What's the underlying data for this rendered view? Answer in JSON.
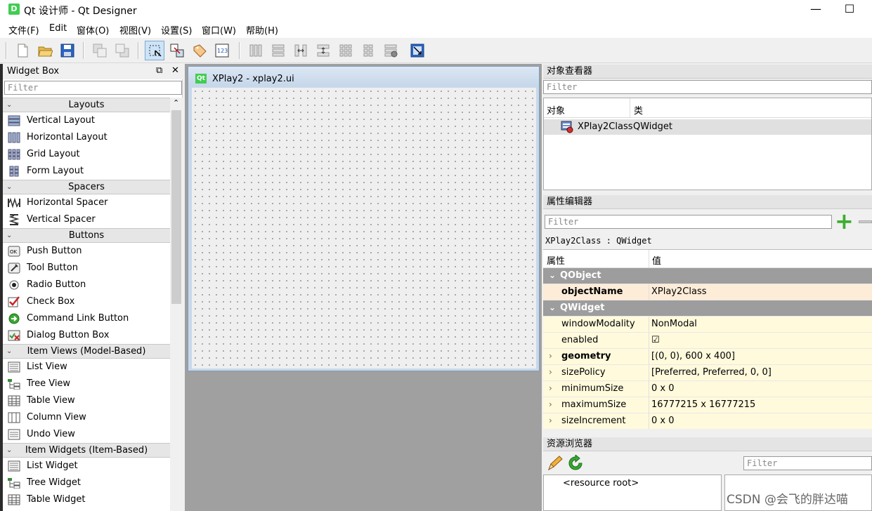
{
  "window": {
    "app_icon_letter": "D",
    "title": "Qt 设计师 - Qt Designer",
    "minimize": "—",
    "maximize": "☐"
  },
  "menu": [
    "文件(F)",
    "Edit",
    "窗体(O)",
    "视图(V)",
    "设置(S)",
    "窗口(W)",
    "帮助(H)"
  ],
  "toolbar": {
    "groups": [
      [
        "new-file-icon",
        "open-folder-icon",
        "save-icon"
      ],
      [
        "send-to-back-icon",
        "bring-to-front-icon"
      ],
      [
        "edit-widgets-icon",
        "edit-signals-slots-icon",
        "edit-buddies-icon",
        "edit-tab-order-icon"
      ],
      [
        "layout-horizontal-icon",
        "layout-vertical-icon",
        "layout-h-splitter-icon",
        "layout-v-splitter-icon",
        "layout-grid-icon",
        "layout-form-icon",
        "break-layout-icon",
        "adjust-size-icon"
      ]
    ],
    "active": "edit-widgets-icon"
  },
  "widget_box": {
    "title": "Widget Box",
    "float_icon": "⧉",
    "close_icon": "✕",
    "filter_placeholder": "Filter",
    "collapse_icon": "⌃",
    "sections": [
      {
        "name": "Layouts",
        "items": [
          {
            "label": "Vertical Layout",
            "icon": "vertical-layout-icon"
          },
          {
            "label": "Horizontal Layout",
            "icon": "horizontal-layout-icon"
          },
          {
            "label": "Grid Layout",
            "icon": "grid-layout-icon"
          },
          {
            "label": "Form Layout",
            "icon": "form-layout-icon"
          }
        ]
      },
      {
        "name": "Spacers",
        "items": [
          {
            "label": "Horizontal Spacer",
            "icon": "horizontal-spacer-icon"
          },
          {
            "label": "Vertical Spacer",
            "icon": "vertical-spacer-icon"
          }
        ]
      },
      {
        "name": "Buttons",
        "items": [
          {
            "label": "Push Button",
            "icon": "push-button-icon"
          },
          {
            "label": "Tool Button",
            "icon": "tool-button-icon"
          },
          {
            "label": "Radio Button",
            "icon": "radio-button-icon"
          },
          {
            "label": "Check Box",
            "icon": "check-box-icon"
          },
          {
            "label": "Command Link Button",
            "icon": "command-link-icon"
          },
          {
            "label": "Dialog Button Box",
            "icon": "dialog-button-box-icon"
          }
        ]
      },
      {
        "name": "Item Views (Model-Based)",
        "items": [
          {
            "label": "List View",
            "icon": "list-view-icon"
          },
          {
            "label": "Tree View",
            "icon": "tree-view-icon"
          },
          {
            "label": "Table View",
            "icon": "table-view-icon"
          },
          {
            "label": "Column View",
            "icon": "column-view-icon"
          },
          {
            "label": "Undo View",
            "icon": "undo-view-icon"
          }
        ]
      },
      {
        "name": "Item Widgets (Item-Based)",
        "items": [
          {
            "label": "List Widget",
            "icon": "list-widget-icon"
          },
          {
            "label": "Tree Widget",
            "icon": "tree-widget-icon"
          },
          {
            "label": "Table Widget",
            "icon": "table-widget-icon"
          }
        ]
      }
    ]
  },
  "form": {
    "badge": "Qt",
    "title": "XPlay2 - xplay2.ui"
  },
  "object_inspector": {
    "title": "对象查看器",
    "filter_placeholder": "Filter",
    "col_object": "对象",
    "col_class": "类",
    "row_object": "XPlay2Class",
    "row_class": "QWidget"
  },
  "property_editor": {
    "title": "属性编辑器",
    "filter_placeholder": "Filter",
    "add_icon": "+",
    "context": "XPlay2Class : QWidget",
    "col_property": "属性",
    "col_value": "值",
    "rows": [
      {
        "type": "group",
        "name": "QObject",
        "expand": "⌄"
      },
      {
        "type": "prop",
        "name": "objectName",
        "value": "XPlay2Class",
        "bold": true,
        "highlight": "#fdecd8",
        "expand": ""
      },
      {
        "type": "group",
        "name": "QWidget",
        "expand": "⌄"
      },
      {
        "type": "prop",
        "name": "windowModality",
        "value": "NonModal",
        "bold": false,
        "highlight": "#fffadc",
        "expand": ""
      },
      {
        "type": "prop",
        "name": "enabled",
        "value": "☑",
        "bold": false,
        "highlight": "#fffadc",
        "expand": ""
      },
      {
        "type": "prop",
        "name": "geometry",
        "value": "[(0, 0), 600 x 400]",
        "bold": true,
        "highlight": "#fffadc",
        "expand": "›"
      },
      {
        "type": "prop",
        "name": "sizePolicy",
        "value": "[Preferred, Preferred, 0, 0]",
        "bold": false,
        "highlight": "#fffadc",
        "expand": "›"
      },
      {
        "type": "prop",
        "name": "minimumSize",
        "value": "0 x 0",
        "bold": false,
        "highlight": "#fffadc",
        "expand": "›"
      },
      {
        "type": "prop",
        "name": "maximumSize",
        "value": "16777215 x 16777215",
        "bold": false,
        "highlight": "#fffadc",
        "expand": "›"
      },
      {
        "type": "prop",
        "name": "sizeIncrement",
        "value": "0 x 0",
        "bold": false,
        "highlight": "#fffadc",
        "expand": "›"
      }
    ]
  },
  "resource_browser": {
    "title": "资源浏览器",
    "filter_placeholder": "Filter",
    "root": "<resource root>",
    "edit_icon": "pencil-icon",
    "reload_icon": "reload-icon"
  },
  "watermark": "CSDN @会飞的胖达喵"
}
